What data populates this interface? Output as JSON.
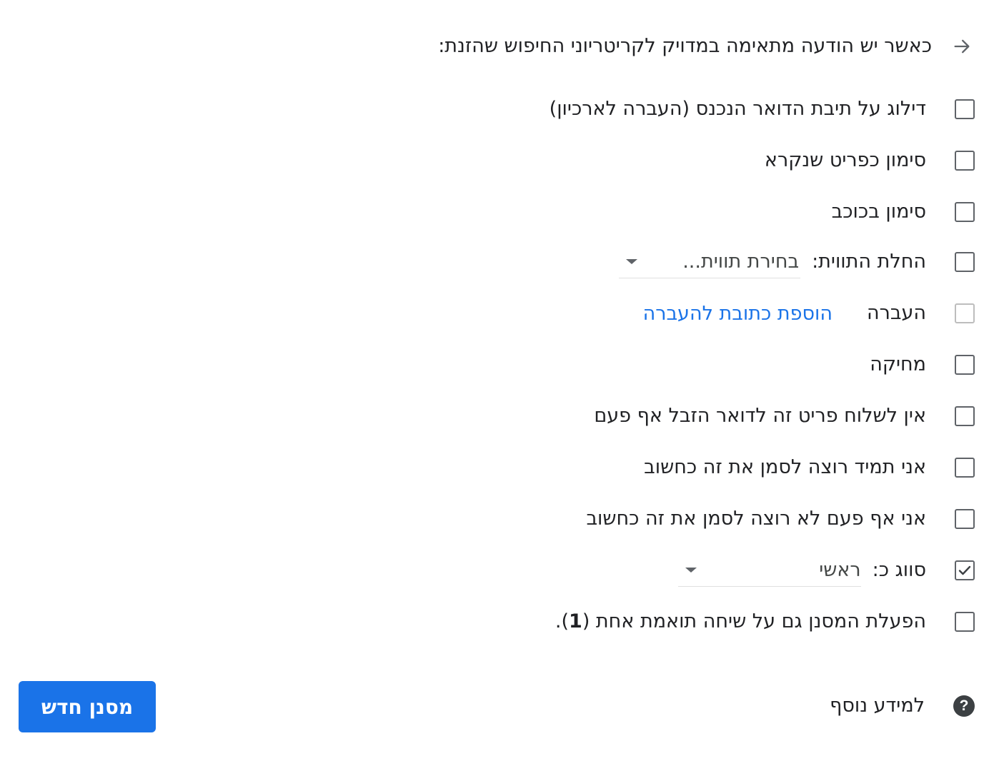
{
  "header": {
    "text": "כאשר יש הודעה מתאימה במדויק לקריטריוני החיפוש שהזנת:"
  },
  "actions": {
    "skip_inbox": {
      "label": "דילוג על תיבת הדואר הנכנס (העברה לארכיון)",
      "checked": false
    },
    "mark_read": {
      "label": "סימון כפריט שנקרא",
      "checked": false
    },
    "star": {
      "label": "סימון בכוכב",
      "checked": false
    },
    "apply_label": {
      "label": "החלת התווית:",
      "select_value": "בחירת תווית...",
      "checked": false
    },
    "forward": {
      "label": "העברה",
      "link": "הוספת כתובת להעברה",
      "checked": false,
      "disabled": true
    },
    "delete": {
      "label": "מחיקה",
      "checked": false
    },
    "never_spam": {
      "label": "אין לשלוח פריט זה לדואר הזבל אף פעם",
      "checked": false
    },
    "always_important": {
      "label": "אני תמיד רוצה לסמן את זה כחשוב",
      "checked": false
    },
    "never_important": {
      "label": "אני אף פעם לא רוצה לסמן את זה כחשוב",
      "checked": false
    },
    "categorize": {
      "label": "סווג כ:",
      "select_value": "ראשי",
      "checked": true
    },
    "apply_existing": {
      "label_before": "הפעלת המסנן גם על שיחה תואמת אחת (",
      "count": "1",
      "label_after": ").",
      "checked": false
    }
  },
  "footer": {
    "help_text": "למידע נוסף",
    "create_button": "מסנן חדש"
  }
}
